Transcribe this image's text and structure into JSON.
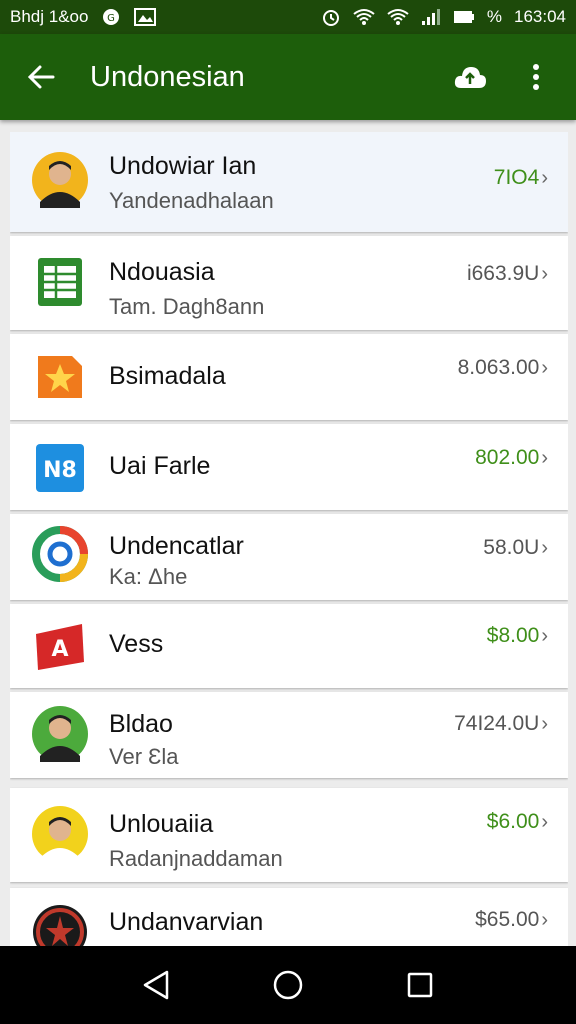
{
  "status_bar": {
    "left_text": "Bhdj 1&oo",
    "time": "163:04",
    "battery_text": "%"
  },
  "app_bar": {
    "title": "Undonesian"
  },
  "colors": {
    "status_bar_bg": "#1d4a0a",
    "app_bar_bg": "#1d5e0b",
    "amount_green": "#3f8f1a",
    "amount_gray": "#555555"
  },
  "items": [
    {
      "name": "Undowiar Ian",
      "sub": "Yandenadhalaan",
      "amount": "7IO4",
      "amount_color": "green",
      "icon": "person-avatar-icon",
      "highlight": true
    },
    {
      "name": "Ndouasia",
      "sub": "Tam. Dagh8ann",
      "amount": "i663.9U",
      "amount_color": "gray",
      "icon": "spreadsheet-app-icon"
    },
    {
      "name": "Bsimadala",
      "sub": "",
      "amount": "8.063.00",
      "amount_color": "gray",
      "icon": "star-app-icon"
    },
    {
      "name": "Uai Farle",
      "sub": "",
      "amount": "802.00",
      "amount_color": "green",
      "icon": "n8-app-icon"
    },
    {
      "name": "Undencatlar",
      "sub": "Ka: Δhe",
      "amount": "58.0U",
      "amount_color": "gray",
      "icon": "ring-app-icon"
    },
    {
      "name": "Vess",
      "sub": "",
      "amount": "$8.00",
      "amount_color": "green",
      "icon": "red-app-icon"
    },
    {
      "name": "Bldao",
      "sub": "Ver Ɛla",
      "amount": "74I24.0U",
      "amount_color": "gray",
      "icon": "person-avatar-icon"
    },
    {
      "name": "Unlouaiia",
      "sub": "Radanjnaddaman",
      "amount": "$6.00",
      "amount_color": "green",
      "icon": "person-avatar-icon"
    },
    {
      "name": "Undanvarvian",
      "sub": "",
      "amount": "$65.00",
      "amount_color": "gray",
      "icon": "emblem-icon"
    }
  ]
}
